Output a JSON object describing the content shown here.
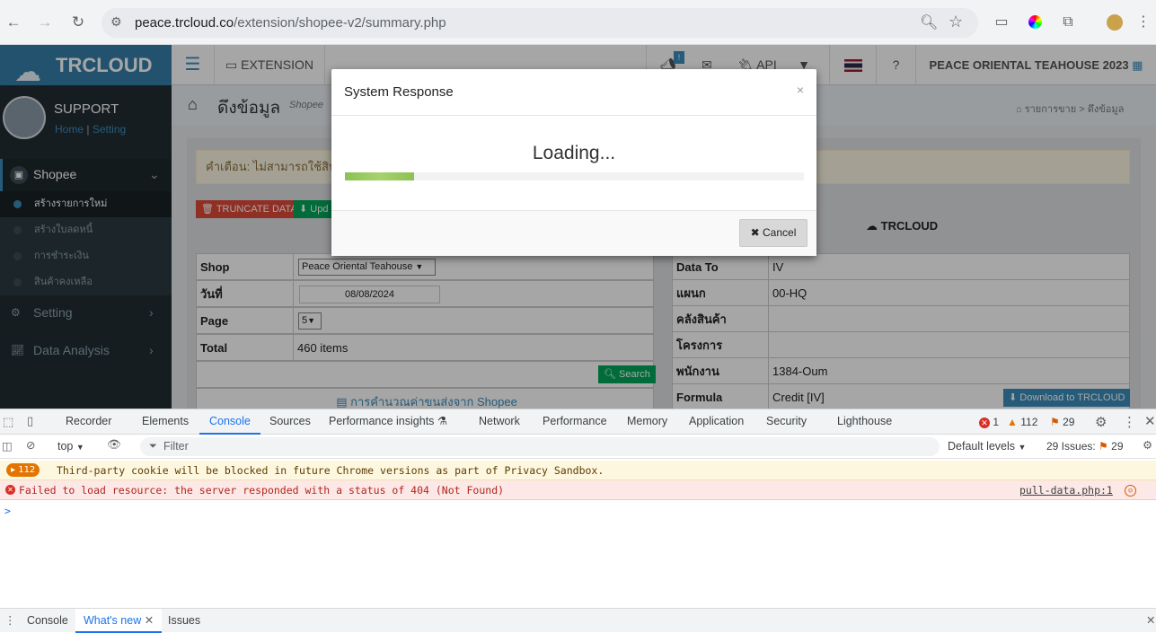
{
  "browser": {
    "url_host": "peace.trcloud.co",
    "url_path": "/extension/shopee-v2/summary.php"
  },
  "sidebar": {
    "brand": "TRCLOUD",
    "user_name": "SUPPORT",
    "link_home": "Home",
    "link_separator": "|",
    "link_setting": "Setting",
    "menu_shopee": "Shopee",
    "sub_items": [
      "สร้างรายการใหม่",
      "สร้างใบลดหนี้",
      "การชำระเงิน",
      "สินค้าคงเหลือ"
    ],
    "menu_setting": "Setting",
    "menu_data_analysis": "Data Analysis"
  },
  "topnav": {
    "extension_label": "EXTENSION",
    "badge": "!",
    "api_label": "API",
    "company": "PEACE ORIENTAL TEAHOUSE 2023"
  },
  "content": {
    "page_title": "ดึงข้อมูล",
    "page_subtitle": "Shopee",
    "breadcrumb_1": "รายการขาย",
    "breadcrumb_sep": ">",
    "breadcrumb_2": "ดึงข้อมูล",
    "warning": "คำเตือน: ไม่สามารถใช้สินค้",
    "truncate_btn": "TRUNCATE DATA",
    "update_btn": "Upd",
    "trcloud_header": "TRCLOUD",
    "left_table": [
      {
        "label": "Shop",
        "value": "Peace Oriental Teahouse"
      },
      {
        "label": "วันที่",
        "value": "08/08/2024"
      },
      {
        "label": "Page",
        "value": "5"
      },
      {
        "label": "Total",
        "value": "460 items"
      }
    ],
    "search_btn": "Search",
    "calc_link": "การคำนวณค่าขนส่งจาก Shopee",
    "right_table": [
      {
        "label": "Data To",
        "value": "IV"
      },
      {
        "label": "แผนก",
        "value": "00-HQ"
      },
      {
        "label": "คลังสินค้า",
        "value": ""
      },
      {
        "label": "โครงการ",
        "value": ""
      },
      {
        "label": "พนักงาน",
        "value": "1384-Oum"
      },
      {
        "label": "Formula",
        "value": "Credit [IV]"
      }
    ],
    "download_btn": "Download to TRCLOUD"
  },
  "modal": {
    "title": "System Response",
    "close": "×",
    "loading_text": "Loading...",
    "progress_percent": 15,
    "cancel_label": "Cancel"
  },
  "devtools": {
    "tabs": [
      "Recorder",
      "Elements",
      "Console",
      "Sources",
      "Performance insights",
      "Network",
      "Performance",
      "Memory",
      "Application",
      "Security",
      "Lighthouse"
    ],
    "active_tab": "Console",
    "errors": "1",
    "warnings": "112",
    "issues_count": "29",
    "context": "top",
    "filter_placeholder": "Filter",
    "levels": "Default levels",
    "issues_label": "29 Issues:",
    "issues_num": "29",
    "msg1_count": "112",
    "msg1": "Third-party cookie will be blocked in future Chrome versions as part of Privacy Sandbox.",
    "msg2": "Failed to load resource: the server responded with a status of 404 (Not Found)",
    "msg2_source": "pull-data.php:1",
    "prompt": ">",
    "bottom_tabs": [
      "Console",
      "What's new",
      "Issues"
    ]
  },
  "colors": {
    "accent": "#1a73e8",
    "brand": "#367fa9",
    "progress": "#8cc153"
  }
}
